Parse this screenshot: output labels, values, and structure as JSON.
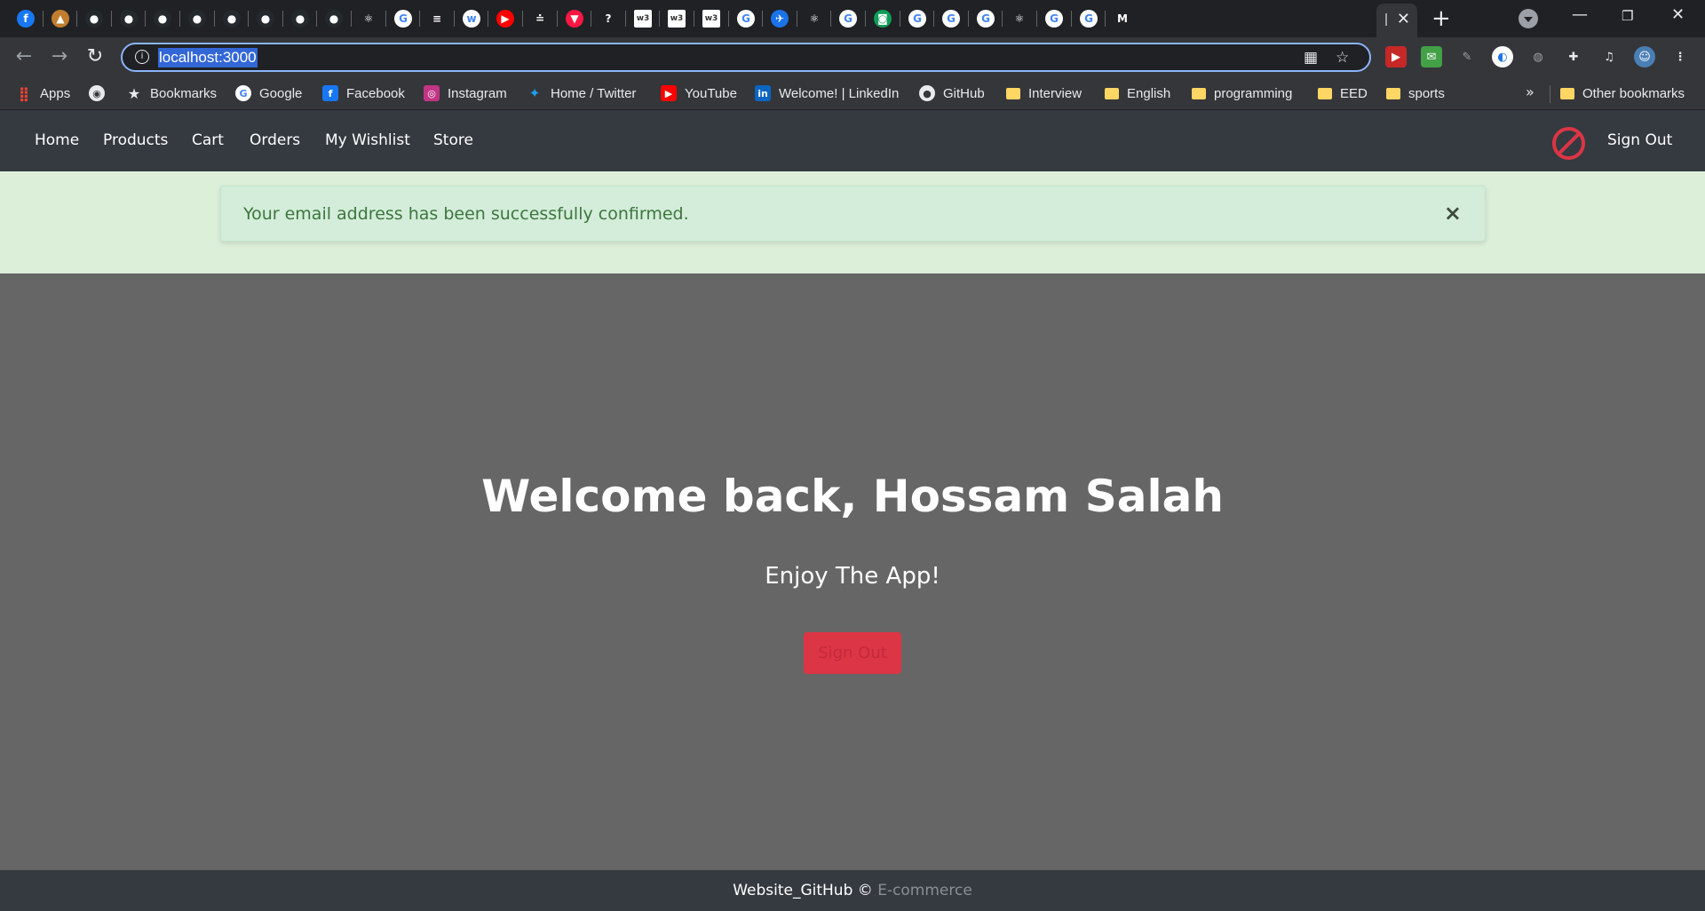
{
  "browser": {
    "tabs": [
      {
        "icon": "facebook-icon",
        "color": "#1877f2",
        "glyph": "f"
      },
      {
        "icon": "tab-icon",
        "color": "#c17d2e",
        "glyph": "▲"
      },
      {
        "icon": "github-icon",
        "color": "#24292e",
        "glyph": "●"
      },
      {
        "icon": "github-icon",
        "color": "#24292e",
        "glyph": "●"
      },
      {
        "icon": "github-icon",
        "color": "#24292e",
        "glyph": "●"
      },
      {
        "icon": "github-icon",
        "color": "#24292e",
        "glyph": "●"
      },
      {
        "icon": "github-icon",
        "color": "#24292e",
        "glyph": "●"
      },
      {
        "icon": "github-icon",
        "color": "#24292e",
        "glyph": "●"
      },
      {
        "icon": "github-icon",
        "color": "#24292e",
        "glyph": "●"
      },
      {
        "icon": "github-icon",
        "color": "#24292e",
        "glyph": "●"
      },
      {
        "icon": "react-icon",
        "color": "#202124",
        "glyph": "⚛"
      },
      {
        "icon": "google-icon",
        "color": "#ffffff",
        "glyph": "G"
      },
      {
        "icon": "stackoverflow-icon",
        "color": "#202124",
        "glyph": "≡"
      },
      {
        "icon": "tab-icon",
        "color": "#ffffff",
        "glyph": "w"
      },
      {
        "icon": "youtube-icon",
        "color": "#ff0000",
        "glyph": "▶"
      },
      {
        "icon": "tab-icon",
        "color": "#202124",
        "glyph": "≐"
      },
      {
        "icon": "tab-icon",
        "color": "#ff1744",
        "glyph": "▼"
      },
      {
        "icon": "tab-icon",
        "color": "#202124",
        "glyph": "?"
      },
      {
        "icon": "w3schools-icon",
        "color": "#ffffff",
        "glyph": "w3"
      },
      {
        "icon": "w3schools-icon",
        "color": "#ffffff",
        "glyph": "w3"
      },
      {
        "icon": "w3schools-icon",
        "color": "#ffffff",
        "glyph": "w3"
      },
      {
        "icon": "google-icon",
        "color": "#ffffff",
        "glyph": "G"
      },
      {
        "icon": "tab-icon",
        "color": "#1a73e8",
        "glyph": "✈"
      },
      {
        "icon": "react-icon",
        "color": "#202124",
        "glyph": "⚛"
      },
      {
        "icon": "google-icon",
        "color": "#ffffff",
        "glyph": "G"
      },
      {
        "icon": "tab-icon",
        "color": "#0f9d58",
        "glyph": "◙"
      },
      {
        "icon": "google-icon",
        "color": "#ffffff",
        "glyph": "G"
      },
      {
        "icon": "google-icon",
        "color": "#ffffff",
        "glyph": "G"
      },
      {
        "icon": "google-icon",
        "color": "#ffffff",
        "glyph": "G"
      },
      {
        "icon": "react-icon",
        "color": "#202124",
        "glyph": "⚛"
      },
      {
        "icon": "google-icon",
        "color": "#ffffff",
        "glyph": "G"
      },
      {
        "icon": "google-icon",
        "color": "#ffffff",
        "glyph": "G"
      },
      {
        "icon": "gmail-icon",
        "color": "#202124",
        "glyph": "M"
      }
    ],
    "url": "localhost:3000",
    "bookmarks": [
      {
        "label": "Apps",
        "icon": "apps-grid-icon"
      },
      {
        "label": "",
        "icon": "globe-icon"
      },
      {
        "label": "Bookmarks",
        "icon": "star-icon"
      },
      {
        "label": "Google",
        "icon": "google-icon"
      },
      {
        "label": "Facebook",
        "icon": "facebook-icon"
      },
      {
        "label": "Instagram",
        "icon": "instagram-icon"
      },
      {
        "label": "Home / Twitter",
        "icon": "twitter-icon"
      },
      {
        "label": "YouTube",
        "icon": "youtube-icon"
      },
      {
        "label": "Welcome! | LinkedIn",
        "icon": "linkedin-icon"
      },
      {
        "label": "GitHub",
        "icon": "github-icon"
      },
      {
        "label": "Interview",
        "icon": "folder-icon"
      },
      {
        "label": "English",
        "icon": "folder-icon"
      },
      {
        "label": "programming",
        "icon": "folder-icon"
      },
      {
        "label": "EED",
        "icon": "folder-icon"
      },
      {
        "label": "sports",
        "icon": "folder-icon"
      }
    ],
    "other_bookmarks": "Other bookmarks",
    "more_chevron": "»"
  },
  "app": {
    "nav": {
      "links": [
        "Home",
        "Products",
        "Cart",
        "Orders",
        "My Wishlist",
        "Store"
      ],
      "sign_out": "Sign Out"
    },
    "alert": {
      "message": "Your email address has been successfully confirmed.",
      "close": "×"
    },
    "main": {
      "welcome": "Welcome back, Hossam Salah",
      "enjoy": "Enjoy The App!",
      "sign_out_button": "Sign Out"
    },
    "footer": {
      "part1": "Website_GitHub ©",
      "part2": "E-commerce"
    }
  }
}
